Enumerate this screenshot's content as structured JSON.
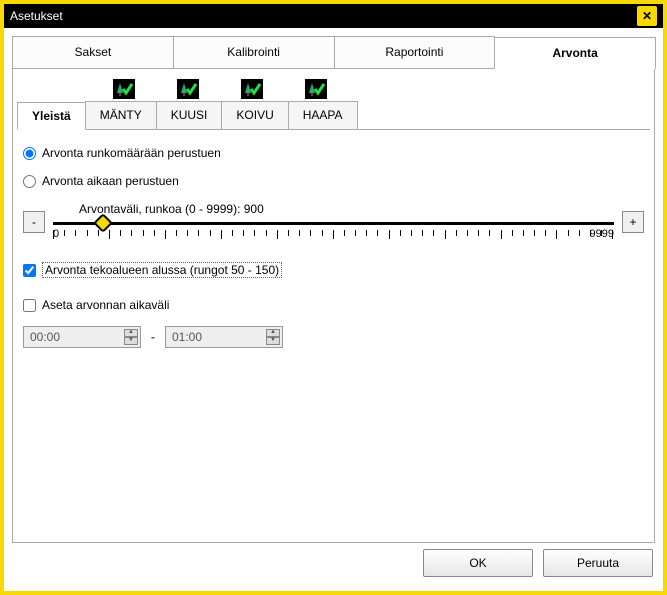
{
  "window": {
    "title": "Asetukset"
  },
  "mainTabs": [
    "Sakset",
    "Kalibrointi",
    "Raportointi",
    "Arvonta"
  ],
  "mainTabActive": 3,
  "subTabs": [
    "Yleistä",
    "MÄNTY",
    "KUUSI",
    "KOIVU",
    "HAAPA"
  ],
  "subTabActive": 0,
  "radios": {
    "byCount": {
      "label": "Arvonta runkomäärään perustuen",
      "checked": true
    },
    "byTime": {
      "label": "Arvonta aikaan perustuen",
      "checked": false
    }
  },
  "slider": {
    "label": "Arvontaväli, runkoa (0 - 9999): 900",
    "min": 0,
    "max": 9999,
    "value": 900,
    "minLabel": "0",
    "maxLabel": "9999",
    "decLabel": "-",
    "incLabel": "+"
  },
  "checks": {
    "startArea": {
      "label": "Arvonta tekoalueen alussa (rungot 50 - 150)",
      "checked": true
    },
    "setInterval": {
      "label": "Aseta arvonnan aikaväli",
      "checked": false
    }
  },
  "time": {
    "from": "00:00",
    "to": "01:00",
    "separator": "-"
  },
  "buttons": {
    "ok": "OK",
    "cancel": "Peruuta"
  }
}
